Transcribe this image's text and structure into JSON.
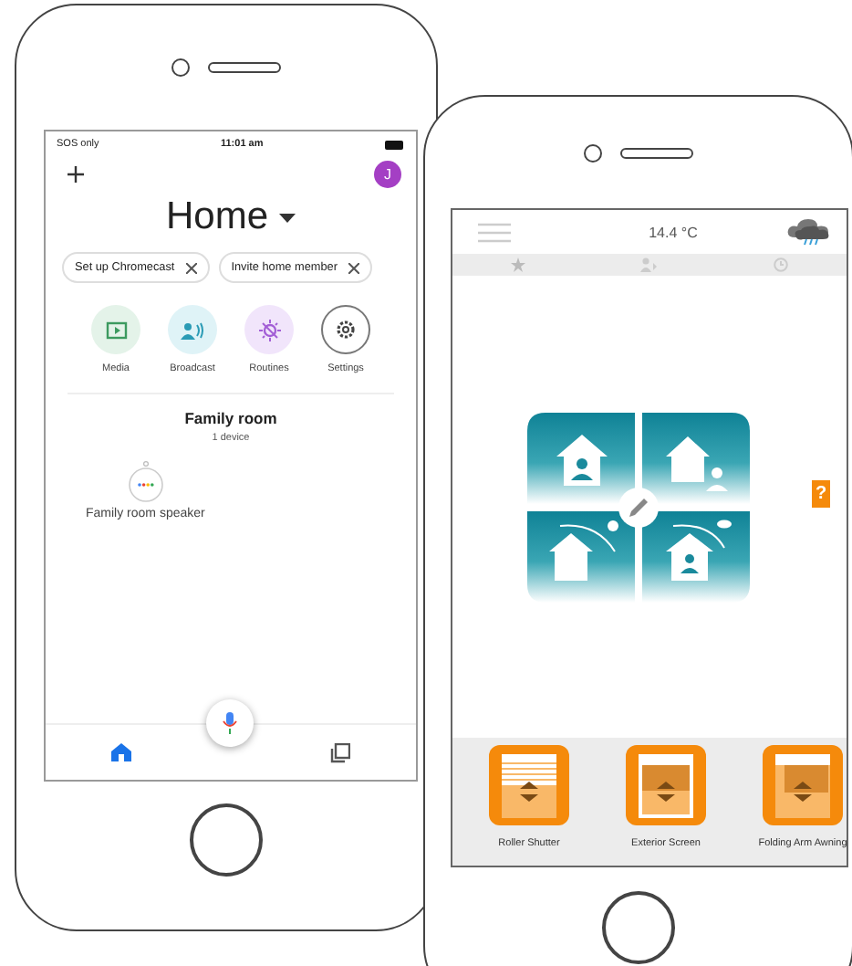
{
  "left_phone": {
    "status_bar": {
      "carrier": "SOS only",
      "time": "11:01 am"
    },
    "avatar": "J",
    "title": "Home",
    "chips": [
      {
        "label": "Set up Chromecast"
      },
      {
        "label": "Invite home member"
      }
    ],
    "shortcuts": [
      {
        "label": "Media",
        "kind": "media",
        "color": "#e4f3e9"
      },
      {
        "label": "Broadcast",
        "kind": "broadcast",
        "color": "#dff3f7"
      },
      {
        "label": "Routines",
        "kind": "routines",
        "color": "#f1e5fb"
      },
      {
        "label": "Settings",
        "kind": "settings",
        "color": "#ffffff"
      }
    ],
    "room": {
      "name": "Family room",
      "count": "1 device",
      "devices": [
        {
          "name": "Family room speaker"
        }
      ]
    },
    "nav": [
      {
        "kind": "home",
        "selected": true
      },
      {
        "kind": "library",
        "selected": false
      }
    ]
  },
  "right_phone": {
    "temperature": "14.4 °C",
    "tabs": [
      {
        "kind": "star"
      },
      {
        "kind": "person"
      },
      {
        "kind": "clock"
      }
    ],
    "help": "?",
    "devices": [
      {
        "label": "Roller Shutter",
        "kind": "shutter"
      },
      {
        "label": "Exterior Screen",
        "kind": "screen"
      },
      {
        "label": "Folding Arm Awning",
        "kind": "awning"
      }
    ]
  }
}
